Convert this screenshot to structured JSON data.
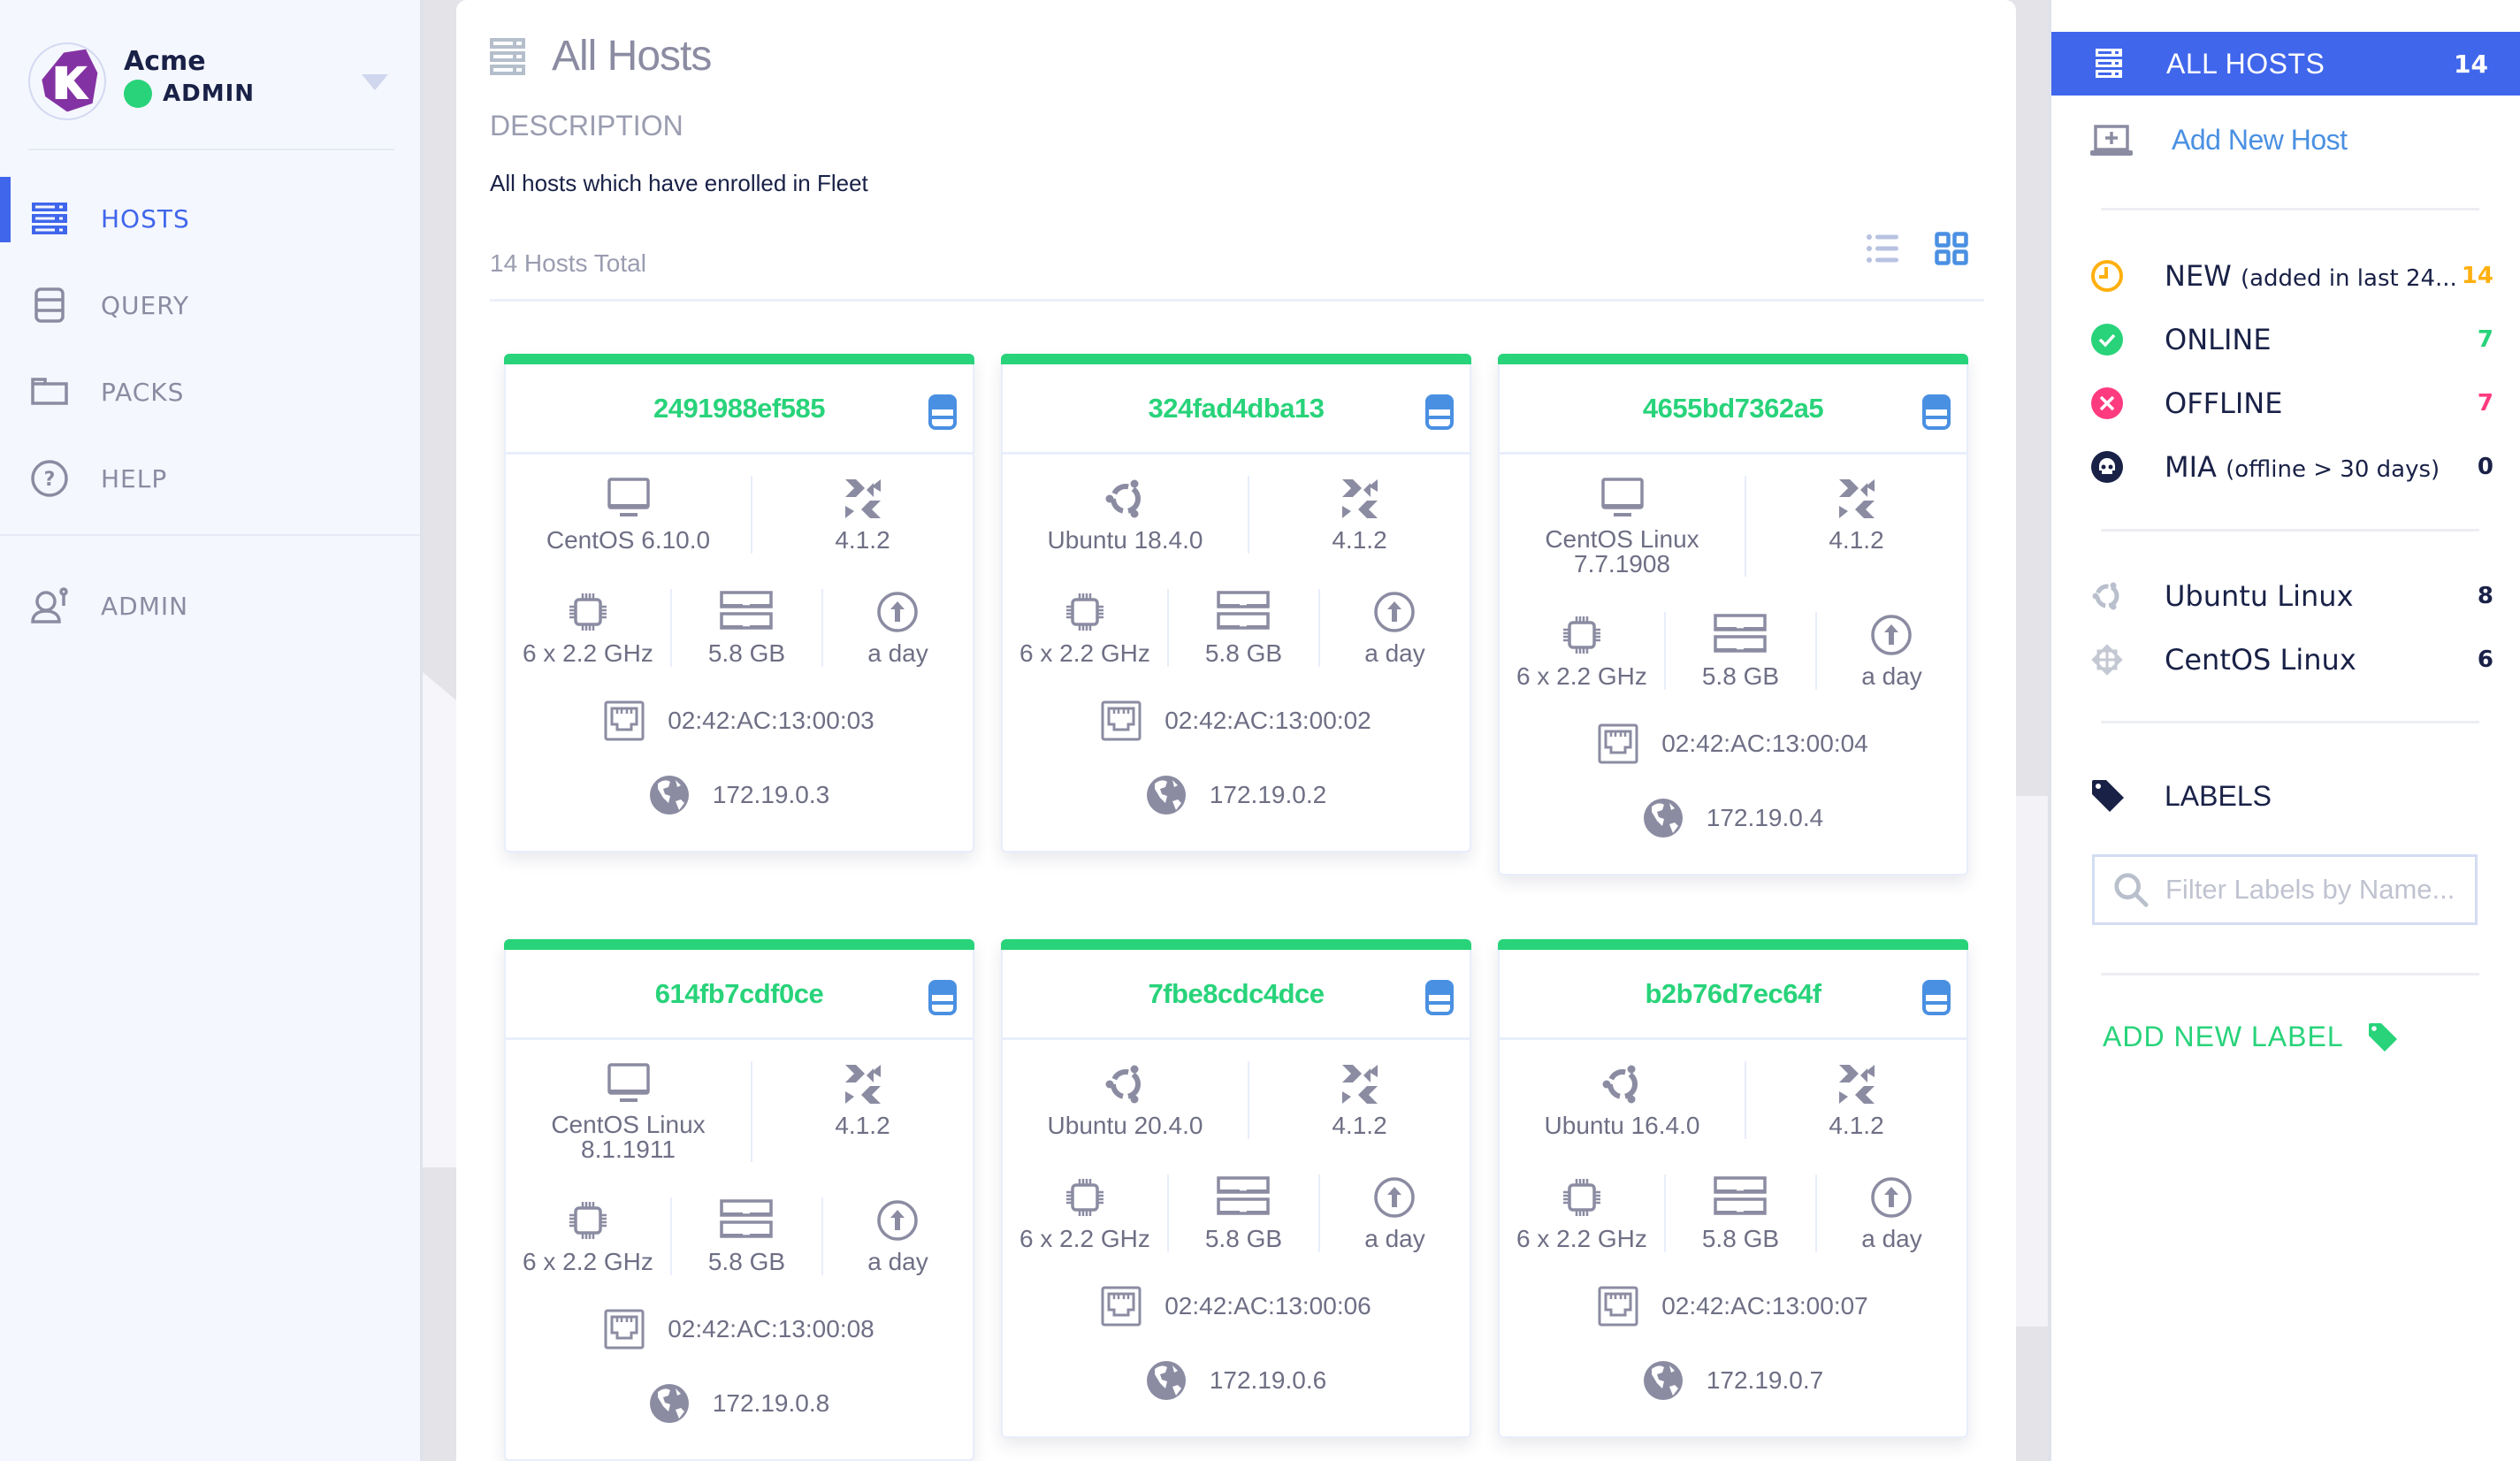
{
  "org": {
    "name": "Acme",
    "role": "ADMIN"
  },
  "nav": {
    "items": [
      {
        "id": "hosts",
        "label": "HOSTS",
        "icon": "server-icon",
        "active": true
      },
      {
        "id": "query",
        "label": "QUERY",
        "icon": "database-icon",
        "active": false
      },
      {
        "id": "packs",
        "label": "PACKS",
        "icon": "folder-icon",
        "active": false
      },
      {
        "id": "help",
        "label": "HELP",
        "icon": "help-circle-icon",
        "active": false
      },
      {
        "id": "admin",
        "label": "ADMIN",
        "icon": "admin-user-icon",
        "active": false
      }
    ]
  },
  "main": {
    "title": "All Hosts",
    "description_label": "DESCRIPTION",
    "description": "All hosts which have enrolled in Fleet",
    "hosts_total": "14 Hosts Total",
    "view_modes": [
      "list",
      "grid"
    ],
    "active_view": "grid"
  },
  "hosts": [
    {
      "hostname": "2491988ef585",
      "os_icon": "desktop-icon",
      "os": "CentOS 6.10.0",
      "osquery": "4.1.2",
      "cpu": "6 x 2.2 GHz",
      "memory": "5.8 GB",
      "uptime": "a day",
      "mac": "02:42:AC:13:00:03",
      "ip": "172.19.0.3",
      "status": "online"
    },
    {
      "hostname": "324fad4dba13",
      "os_icon": "ubuntu-icon",
      "os": "Ubuntu 18.4.0",
      "osquery": "4.1.2",
      "cpu": "6 x 2.2 GHz",
      "memory": "5.8 GB",
      "uptime": "a day",
      "mac": "02:42:AC:13:00:02",
      "ip": "172.19.0.2",
      "status": "online"
    },
    {
      "hostname": "4655bd7362a5",
      "os_icon": "desktop-icon",
      "os": "CentOS Linux 7.7.1908",
      "osquery": "4.1.2",
      "cpu": "6 x 2.2 GHz",
      "memory": "5.8 GB",
      "uptime": "a day",
      "mac": "02:42:AC:13:00:04",
      "ip": "172.19.0.4",
      "status": "online"
    },
    {
      "hostname": "614fb7cdf0ce",
      "os_icon": "desktop-icon",
      "os": "CentOS Linux 8.1.1911",
      "osquery": "4.1.2",
      "cpu": "6 x 2.2 GHz",
      "memory": "5.8 GB",
      "uptime": "a day",
      "mac": "02:42:AC:13:00:08",
      "ip": "172.19.0.8",
      "status": "online"
    },
    {
      "hostname": "7fbe8cdc4dce",
      "os_icon": "ubuntu-icon",
      "os": "Ubuntu 20.4.0",
      "osquery": "4.1.2",
      "cpu": "6 x 2.2 GHz",
      "memory": "5.8 GB",
      "uptime": "a day",
      "mac": "02:42:AC:13:00:06",
      "ip": "172.19.0.6",
      "status": "online"
    },
    {
      "hostname": "b2b76d7ec64f",
      "os_icon": "ubuntu-icon",
      "os": "Ubuntu 16.4.0",
      "osquery": "4.1.2",
      "cpu": "6 x 2.2 GHz",
      "memory": "5.8 GB",
      "uptime": "a day",
      "mac": "02:42:AC:13:00:07",
      "ip": "172.19.0.7",
      "status": "online"
    }
  ],
  "right_panel": {
    "all_hosts": {
      "label": "ALL HOSTS",
      "count": "14"
    },
    "add_host_label": "Add New Host",
    "status_filters": [
      {
        "id": "new",
        "label": "NEW",
        "sublabel": "(added in last 24...",
        "count": "14",
        "icon": "clock-icon",
        "color": "#ffb00f"
      },
      {
        "id": "online",
        "label": "ONLINE",
        "sublabel": "",
        "count": "7",
        "icon": "check-circle-icon",
        "color": "#28d37a"
      },
      {
        "id": "offline",
        "label": "OFFLINE",
        "sublabel": "",
        "count": "7",
        "icon": "x-circle-icon",
        "color": "#ff3b80"
      },
      {
        "id": "mia",
        "label": "MIA",
        "sublabel": "(offline > 30 days)",
        "count": "0",
        "icon": "skull-icon",
        "color": "#192147"
      }
    ],
    "platform_filters": [
      {
        "id": "ubuntu",
        "label": "Ubuntu Linux",
        "count": "8",
        "icon": "ubuntu-icon"
      },
      {
        "id": "centos",
        "label": "CentOS Linux",
        "count": "6",
        "icon": "centos-icon"
      }
    ],
    "labels_title": "LABELS",
    "labels_filter_placeholder": "Filter Labels by Name...",
    "add_label": "ADD NEW LABEL"
  },
  "colors": {
    "accent": "#4066ec",
    "online": "#28d37a",
    "link": "#4a90e2",
    "text_dark": "#192147",
    "text_muted": "#8b8ca2"
  }
}
